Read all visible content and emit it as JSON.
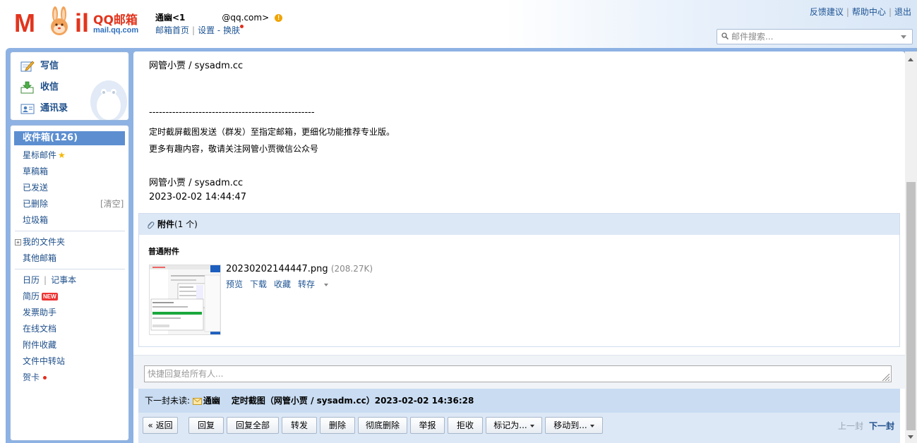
{
  "header": {
    "logo": {
      "brand": "M il",
      "product": "QQ邮箱",
      "domain": "mail.qq.com"
    },
    "user": {
      "nickname": "通幽<1",
      "email": "@qq.com>"
    },
    "sublinks": {
      "home": "邮箱首页",
      "settings": "设置",
      "dash": "-",
      "skin": "换肤"
    },
    "toplinks": {
      "feedback": "反馈建议",
      "help": "帮助中心",
      "logout": "退出"
    },
    "search": {
      "placeholder": "邮件搜索..."
    }
  },
  "sidebar": {
    "compose": {
      "write": "写信",
      "receive": "收信",
      "contacts": "通讯录"
    },
    "folders": {
      "inbox": "收件箱(126)",
      "starred": "星标邮件",
      "drafts": "草稿箱",
      "sent": "已发送",
      "deleted": "已删除",
      "clear": "[清空]",
      "junk": "垃圾箱",
      "my_folders": "我的文件夹",
      "other_mail": "其他邮箱",
      "calendar": "日历",
      "notebook": "记事本",
      "resume": "简历",
      "resume_badge": "NEW",
      "invoice": "发票助手",
      "online_docs": "在线文档",
      "attach_fav": "附件收藏",
      "transfer": "文件中转站",
      "greeting": "贺卡"
    }
  },
  "mail": {
    "lines": {
      "sign1": "网管小贾 / sysadm.cc",
      "divider": "--------------------------------------------------",
      "promo1": "定时截屏截图发送（群发）至指定邮箱，更细化功能推荐专业版。",
      "promo2": "更多有趣内容，敬请关注网管小贾微信公众号",
      "sign2": "网管小贾 / sysadm.cc",
      "datetime": "2023-02-02 14:44:47"
    },
    "attachments": {
      "title": "附件",
      "count": "(1 个)",
      "section": "普通附件",
      "file": {
        "name": "20230202144447.png",
        "size": "(208.27K)"
      },
      "actions": {
        "preview": "预览",
        "download": "下载",
        "favorite": "收藏",
        "save_to": "转存"
      }
    },
    "reply": {
      "placeholder": "快捷回复给所有人..."
    },
    "next_unread": {
      "label": "下一封未读:",
      "sender": "通幽",
      "subject": "定时截图（网管小贾 / sysadm.cc）2023-02-02 14:36:28"
    },
    "toolbar": {
      "back": "« 返回",
      "reply": "回复",
      "reply_all": "回复全部",
      "forward": "转发",
      "delete": "删除",
      "delete_forever": "彻底删除",
      "report": "举报",
      "reject": "拒收",
      "mark_as": "标记为...",
      "move_to": "移动到...",
      "prev": "上一封",
      "next": "下一封"
    }
  },
  "colors": {
    "frame": "#8db2e3",
    "inbox_highlight": "#5d8fd0",
    "link": "#1e5494",
    "logo_red": "#e2351e"
  }
}
